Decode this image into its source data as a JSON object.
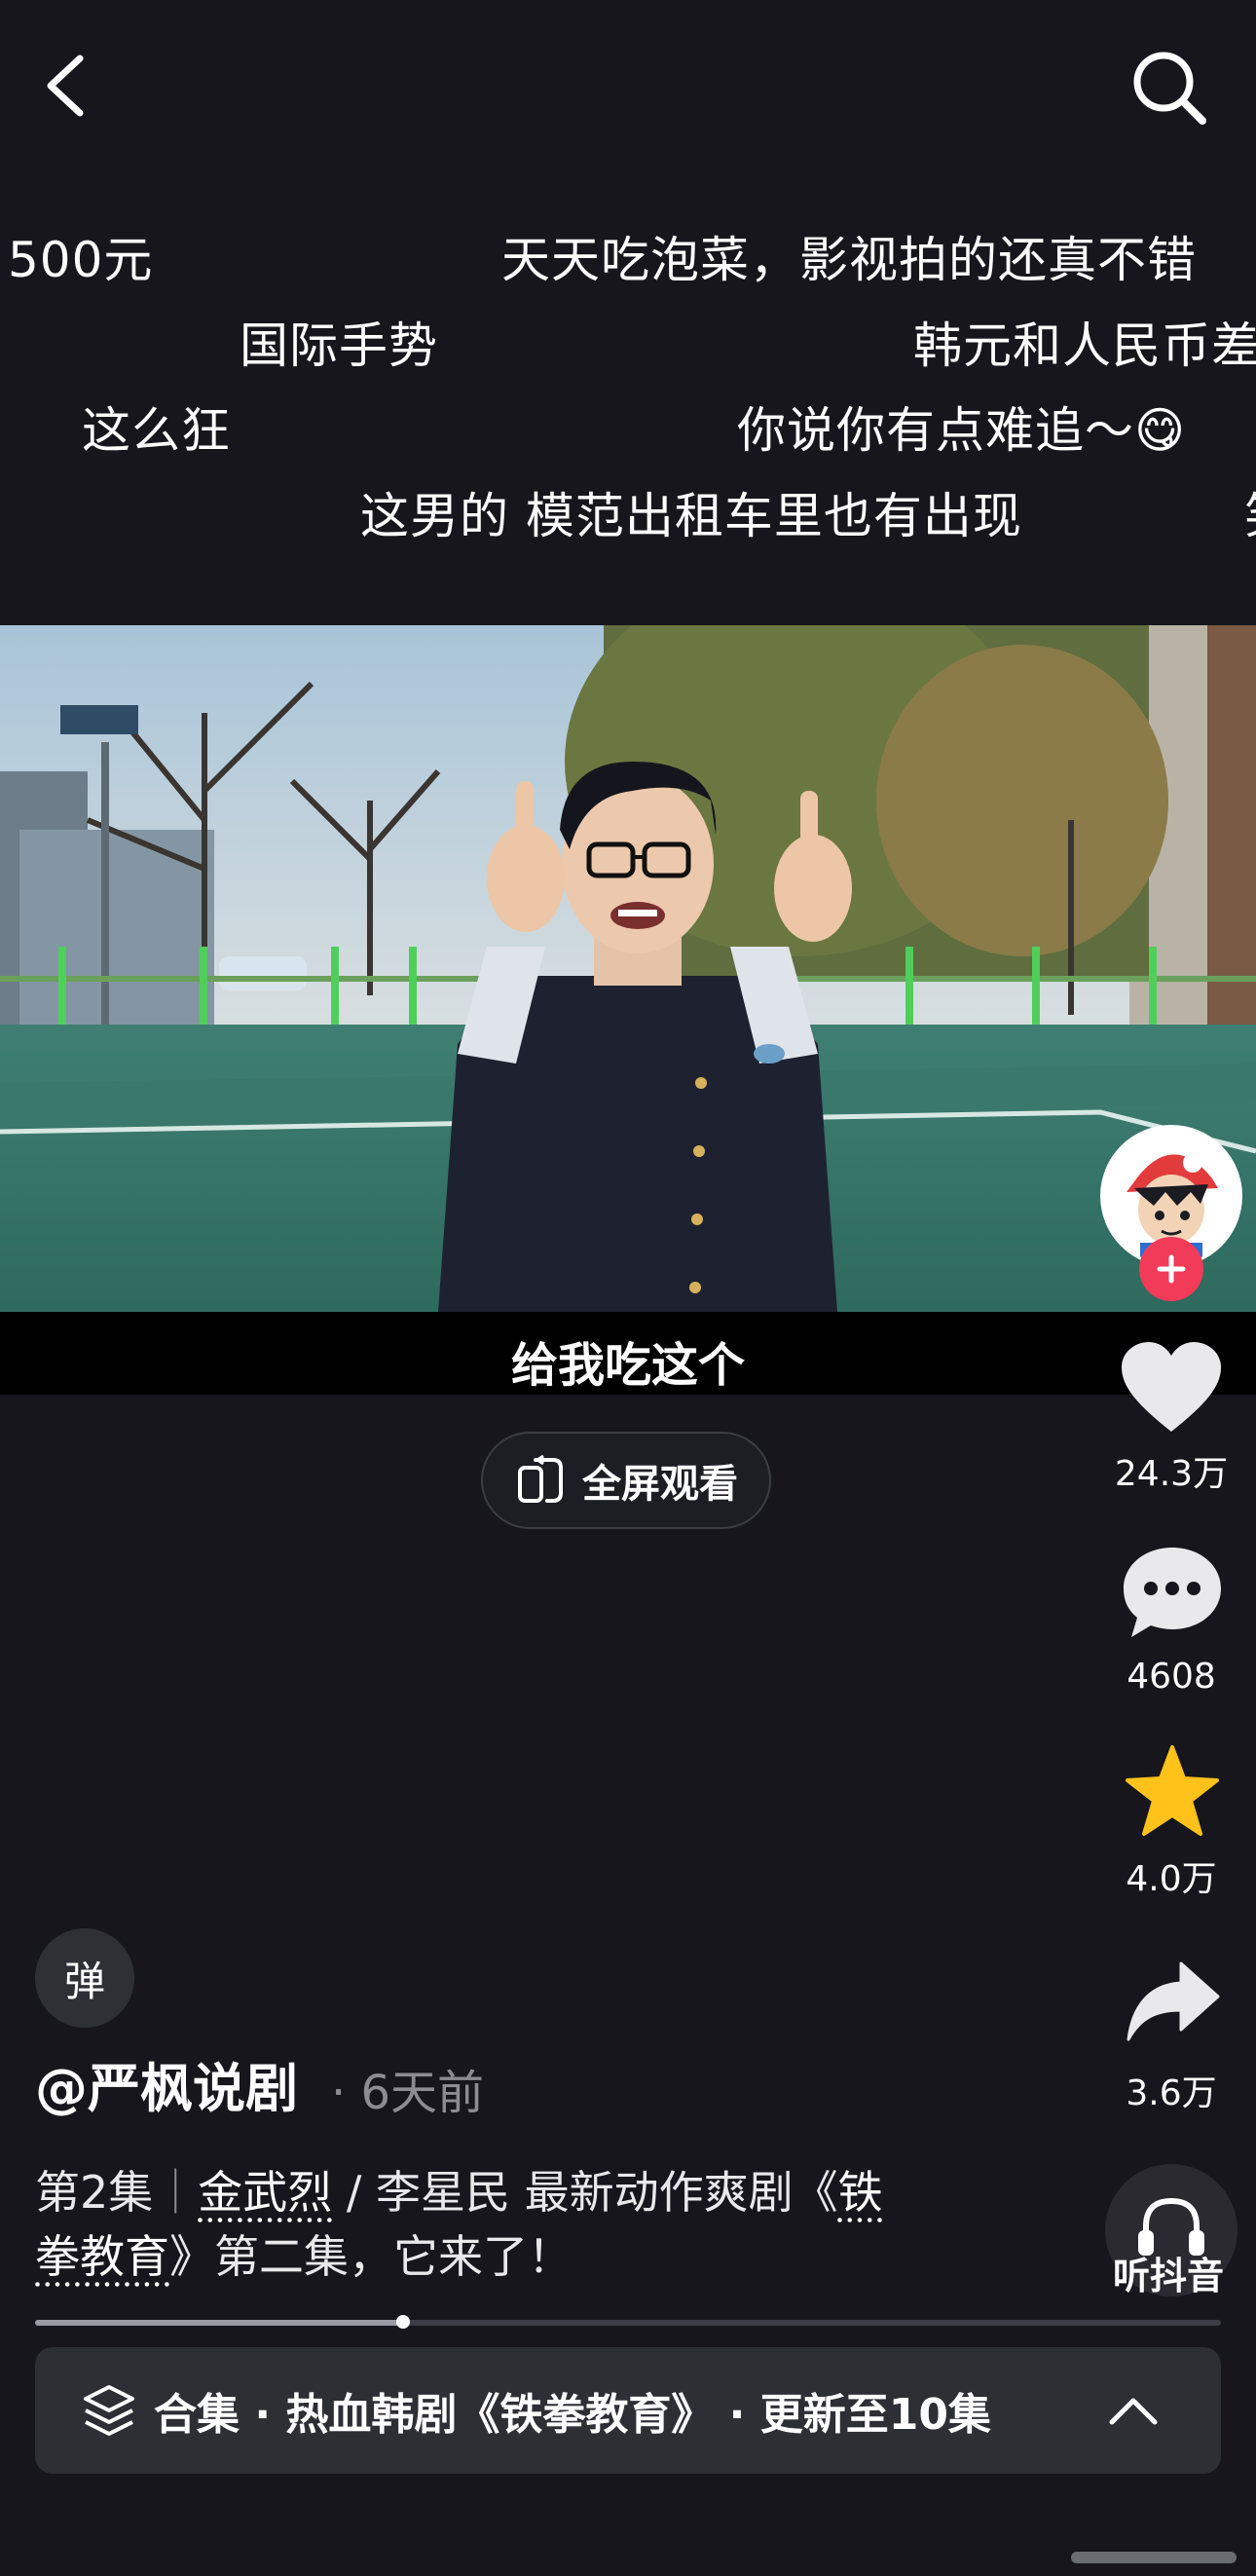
{
  "danmaku": [
    {
      "text": "500元"
    },
    {
      "text": "天天吃泡菜，影视拍的还真不错"
    },
    {
      "text": "国际手势"
    },
    {
      "text": "韩元和人民币差"
    },
    {
      "text": "这么狂"
    },
    {
      "text": "你说你有点难追～😋"
    },
    {
      "text": "这男的 模范出租车里也有出现"
    },
    {
      "text": "笑"
    }
  ],
  "video": {
    "subtitle": "给我吃这个"
  },
  "fullscreen": {
    "label": "全屏观看"
  },
  "actions": {
    "likes": "24.3万",
    "comments": "4608",
    "favorites": "4.0万",
    "shares": "3.6万",
    "music_label": "听抖音"
  },
  "danmu_toggle": {
    "label": "弹"
  },
  "post": {
    "author": "@严枫说剧",
    "time_ago": "· 6天前",
    "desc_episode": "第2集",
    "desc_sep": "｜",
    "desc_actor1": "金武烈",
    "desc_mid": " / 李星民 最新动作爽剧《",
    "desc_title_a": "铁",
    "desc_title_b": "拳教育",
    "desc_end": "》第二集，它来了！"
  },
  "progress": {
    "fraction": 0.31
  },
  "collection": {
    "label": "合集 · 热血韩剧《铁拳教育》 · 更新至10集"
  },
  "colors": {
    "background": "#16161c",
    "like_icon": "#e9e9ec",
    "favorite_star": "#ffc21a",
    "follow_button": "#f23a59"
  },
  "icons": [
    "back-icon",
    "search-icon",
    "heart-icon",
    "comment-icon",
    "star-icon",
    "share-icon",
    "headphones-icon",
    "layers-icon",
    "chevron-up-icon",
    "fullscreen-icon"
  ]
}
